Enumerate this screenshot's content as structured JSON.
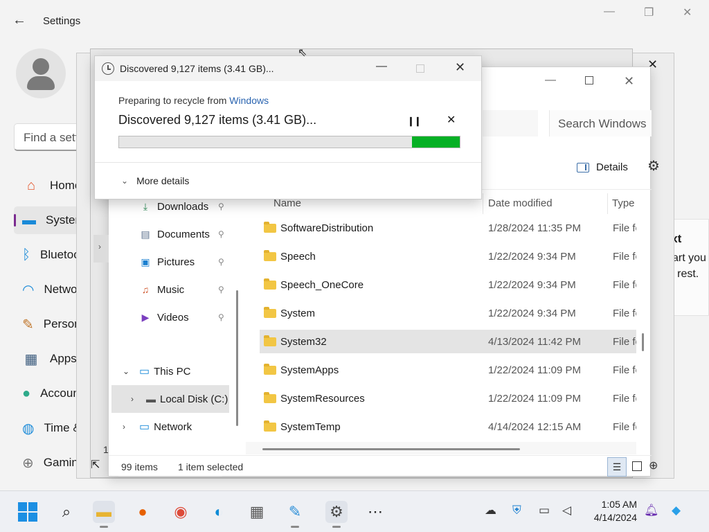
{
  "settings": {
    "title": "Settings",
    "search_placeholder": "Find a setting",
    "nav": [
      {
        "label": "Home",
        "icon": "home-icon",
        "glyph": "⌂",
        "color": "#e4572e"
      },
      {
        "label": "System",
        "icon": "system-icon",
        "glyph": "▬",
        "color": "#1a8ad8"
      },
      {
        "label": "Bluetooth & devices",
        "icon": "bluetooth-icon",
        "glyph": "ᛒ",
        "color": "#1a8ad8"
      },
      {
        "label": "Network & internet",
        "icon": "wifi-icon",
        "glyph": "◠",
        "color": "#1a8ad8"
      },
      {
        "label": "Personalization",
        "icon": "brush-icon",
        "glyph": "✎",
        "color": "#c0762b"
      },
      {
        "label": "Apps",
        "icon": "apps-icon",
        "glyph": "▦",
        "color": "#3a5a7c"
      },
      {
        "label": "Accounts",
        "icon": "accounts-icon",
        "glyph": "●",
        "color": "#2eaa8a"
      },
      {
        "label": "Time & language",
        "icon": "globe-icon",
        "glyph": "◍",
        "color": "#1a8ad8"
      },
      {
        "label": "Gaming",
        "icon": "gamepad-icon",
        "glyph": "⊕",
        "color": "#777777"
      }
    ],
    "right_panel": {
      "line1": "n text",
      "line2": "e or art you",
      "line3": "s the rest."
    }
  },
  "dialog": {
    "title": "Discovered 9,127 items (3.41 GB)...",
    "preparing_prefix": "Preparing to recycle from ",
    "source": "Windows",
    "headline": "Discovered 9,127 items (3.41 GB)...",
    "progress_fraction": 0.14,
    "more_details": "More details",
    "bar_color": "#06b025"
  },
  "explorer": {
    "search_placeholder": "Search Windows",
    "details_label": "Details",
    "quick_access": [
      {
        "label": "Downloads",
        "icon": "downloads-icon",
        "glyph": "⤓",
        "color": "#2e8b57"
      },
      {
        "label": "Documents",
        "icon": "documents-icon",
        "glyph": "▤",
        "color": "#5a6f8c"
      },
      {
        "label": "Pictures",
        "icon": "pictures-icon",
        "glyph": "▣",
        "color": "#1a7fd0"
      },
      {
        "label": "Music",
        "icon": "music-icon",
        "glyph": "♫",
        "color": "#d0572e"
      },
      {
        "label": "Videos",
        "icon": "videos-icon",
        "glyph": "▶",
        "color": "#7b3fbf"
      }
    ],
    "tree": {
      "this_pc": "This PC",
      "local_disk": "Local Disk (C:)",
      "network": "Network"
    },
    "columns": {
      "name": "Name",
      "date": "Date modified",
      "type": "Type"
    },
    "files": [
      {
        "name": "SoftwareDistribution",
        "date": "1/28/2024 11:35 PM",
        "type": "File folder"
      },
      {
        "name": "Speech",
        "date": "1/22/2024 9:34 PM",
        "type": "File folder"
      },
      {
        "name": "Speech_OneCore",
        "date": "1/22/2024 9:34 PM",
        "type": "File folder"
      },
      {
        "name": "System",
        "date": "1/22/2024 9:34 PM",
        "type": "File folder"
      },
      {
        "name": "System32",
        "date": "4/13/2024 11:42 PM",
        "type": "File folder",
        "selected": true
      },
      {
        "name": "SystemApps",
        "date": "1/22/2024 11:09 PM",
        "type": "File folder"
      },
      {
        "name": "SystemResources",
        "date": "1/22/2024 11:09 PM",
        "type": "File folder"
      },
      {
        "name": "SystemTemp",
        "date": "4/14/2024 12:15 AM",
        "type": "File folder"
      }
    ],
    "status": {
      "count": "99 items",
      "selected": "1 item selected"
    },
    "left_count": "1"
  },
  "taskbar": {
    "time": "1:05 AM",
    "date": "4/14/2024"
  }
}
